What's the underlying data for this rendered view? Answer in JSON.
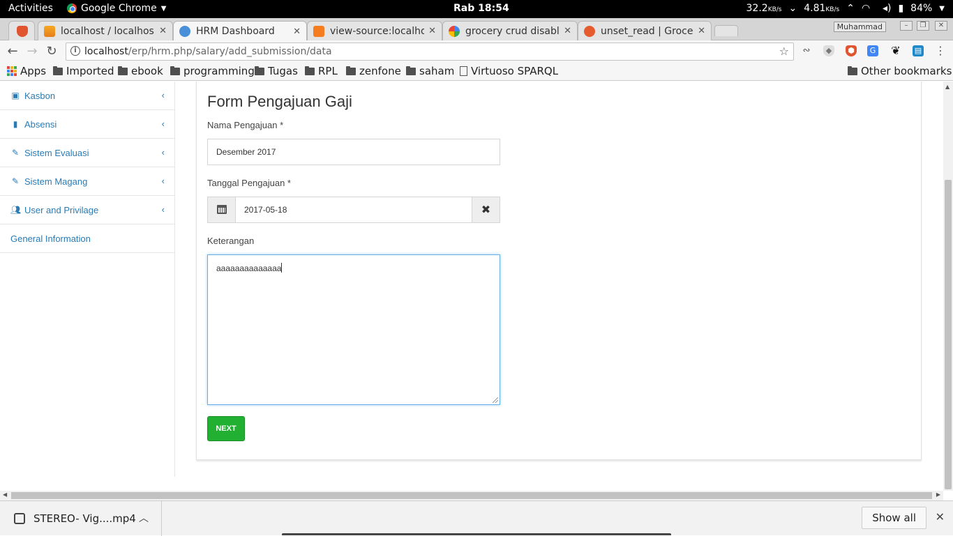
{
  "system_bar": {
    "activities": "Activities",
    "app_name": "Google Chrome",
    "clock": "Rab 18:54",
    "net_down": "32.2",
    "net_down_unit": "KB/s",
    "net_up": "4.81",
    "net_up_unit": "KB/s",
    "battery": "84%"
  },
  "tabs": [
    {
      "title": "localhost / localhos",
      "icon": "phpmyadmin-icon",
      "active": false
    },
    {
      "title": "HRM Dashboard",
      "icon": "hrm-icon",
      "active": true
    },
    {
      "title": "view-source:localho",
      "icon": "xampp-icon",
      "active": false
    },
    {
      "title": "grocery crud disable",
      "icon": "google-icon",
      "active": false
    },
    {
      "title": "unset_read | Groce",
      "icon": "grocery-crud-icon",
      "active": false
    }
  ],
  "profile_name": "Muhammad",
  "address_bar": {
    "host": "localhost",
    "path": "/erp/hrm.php/salary/add_submission/data"
  },
  "bookmarks": {
    "items": [
      "Apps",
      "Imported",
      "ebook",
      "programming",
      "Tugas",
      "RPL",
      "zenfone",
      "saham",
      "Virtuoso SPARQL"
    ],
    "other": "Other bookmarks"
  },
  "sidebar": {
    "items": [
      {
        "label": "Kasbon",
        "icon": "money-icon",
        "has_submenu": true
      },
      {
        "label": "Absensi",
        "icon": "book-icon",
        "has_submenu": true
      },
      {
        "label": "Sistem Evaluasi",
        "icon": "edit-icon",
        "has_submenu": true
      },
      {
        "label": "Sistem Magang",
        "icon": "edit-icon",
        "has_submenu": true
      },
      {
        "label": "User and Privilage",
        "icon": "users-icon",
        "has_submenu": true
      },
      {
        "label": "General Information",
        "icon": "",
        "has_submenu": false
      }
    ]
  },
  "form": {
    "title": "Form Pengajuan Gaji",
    "name_label": "Nama Pengajuan *",
    "name_value": "Desember 2017",
    "date_label": "Tanggal Pengajuan *",
    "date_value": "2017-05-18",
    "note_label": "Keterangan",
    "note_value": "aaaaaaaaaaaaaa",
    "next_label": "NEXT"
  },
  "downloads": {
    "file": "STEREO- Vig....mp4",
    "show_all": "Show all"
  },
  "colors": {
    "link_blue": "#2a7bb5",
    "next_green": "#21b032",
    "focus_blue": "#66afe9"
  }
}
